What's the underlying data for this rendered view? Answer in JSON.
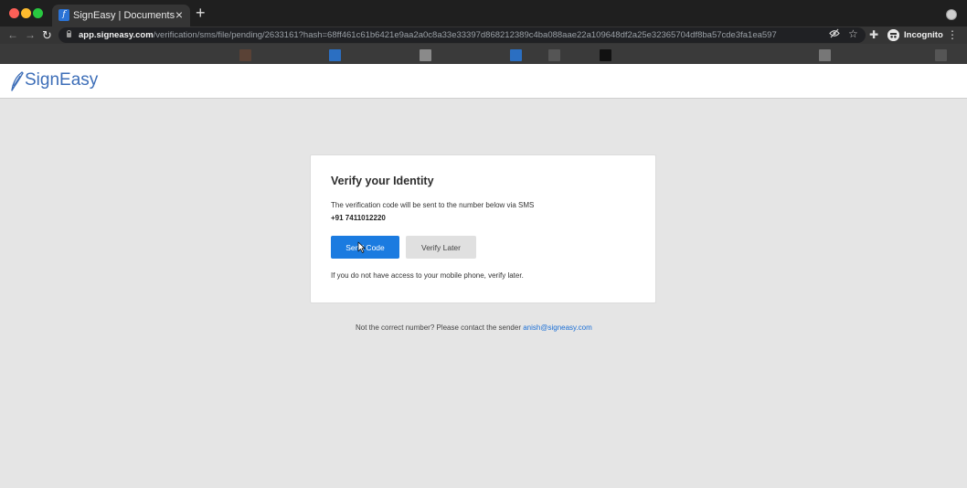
{
  "browser": {
    "tab_title": "SignEasy | Documents",
    "tab_close": "×",
    "new_tab": "+",
    "url_host": "app.signeasy.com",
    "url_path": "/verification/sms/file/pending/2633161?hash=68ff461c61b6421e9aa2a0c8a33e33397d868212389c4ba088aae22a109648df2a25e32365704df8ba57cde3fa1ea597",
    "profile_label": "Incognito",
    "icons": [
      "back-icon",
      "forward-icon",
      "reload-icon",
      "lock-icon",
      "eye-off-icon",
      "star-icon",
      "extensions-icon",
      "incognito-icon",
      "menu-icon"
    ]
  },
  "bookmarks": [
    {
      "color": "#5a4236"
    },
    {
      "color": "#2b6fc2"
    },
    {
      "color": "#8a8a8a"
    },
    {
      "color": "#2b6fc2"
    },
    {
      "color": "#555555"
    },
    {
      "color": "#111111"
    },
    {
      "color": "#777777"
    },
    {
      "color": "#555555"
    }
  ],
  "app": {
    "logo_text": "SignEasy",
    "brand_color": "#3d6eb8"
  },
  "verify": {
    "title": "Verify your Identity",
    "description": "The verification code will be sent to the number below via SMS",
    "phone": "+91 7411012220",
    "send_button": "Send Code",
    "later_button": "Verify Later",
    "note": "If you do not have access to your mobile phone, verify later.",
    "primary_color": "#1b7be0"
  },
  "footer": {
    "text": "Not the correct number? Please contact the sender ",
    "email": "anish@signeasy.com"
  }
}
